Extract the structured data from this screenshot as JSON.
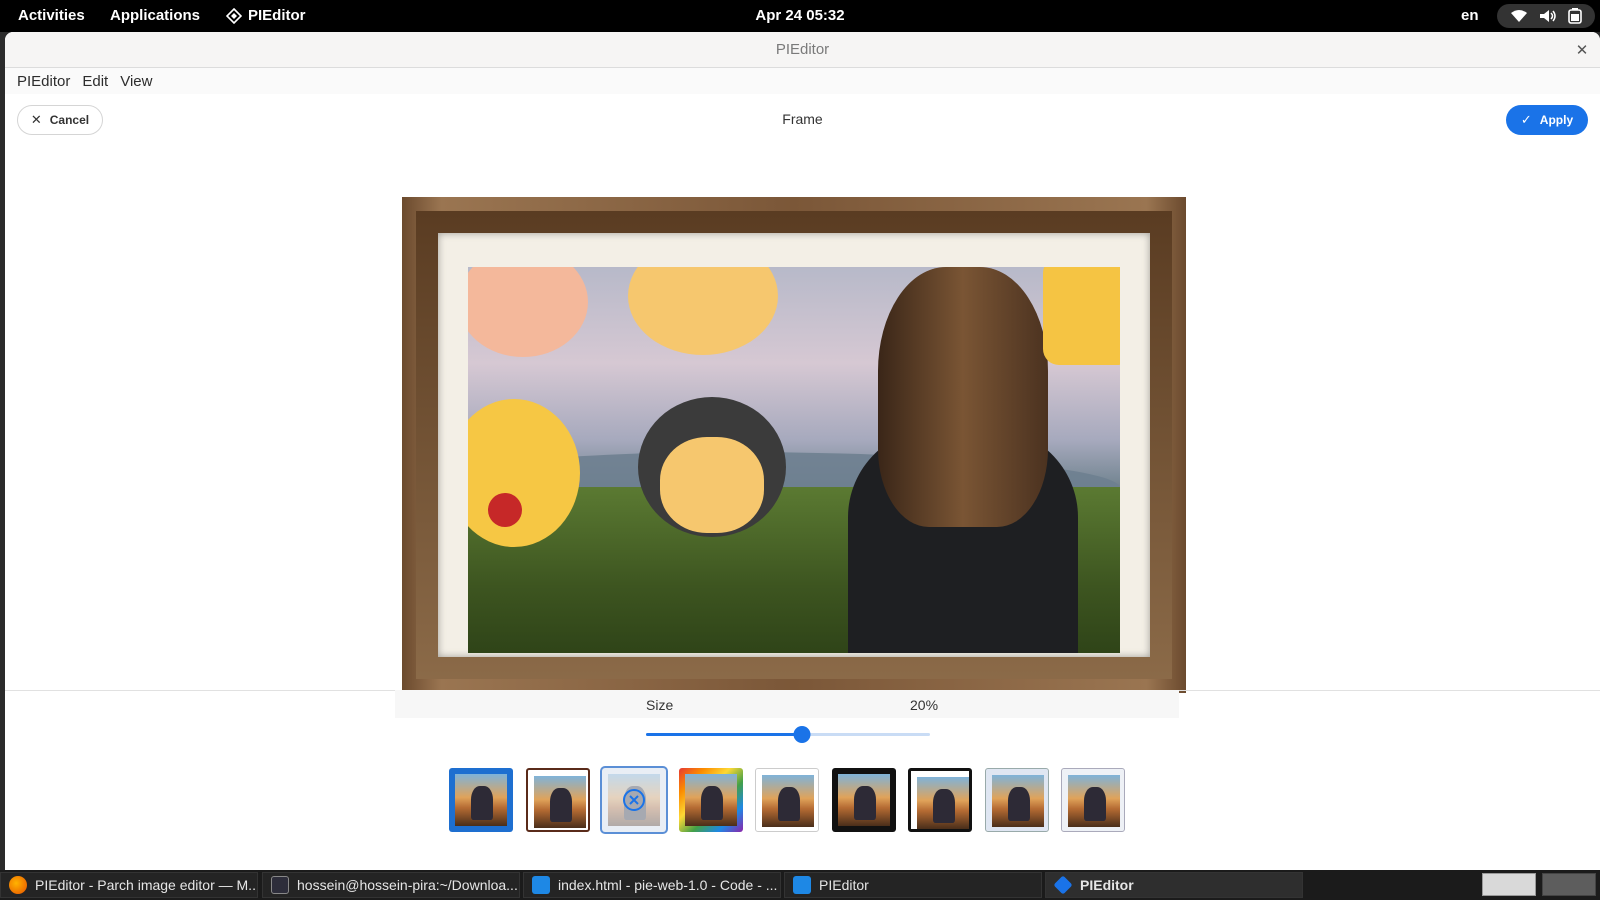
{
  "topbar": {
    "activities": "Activities",
    "applications": "Applications",
    "app_name": "PIEditor",
    "clock": "Apr 24  05:32",
    "lang": "en"
  },
  "window": {
    "title": "PIEditor",
    "menu": [
      "PIEditor",
      "Edit",
      "View"
    ]
  },
  "toolbar": {
    "cancel_label": "Cancel",
    "title": "Frame",
    "apply_label": "Apply",
    "accent": "#1a73e8"
  },
  "size_control": {
    "label": "Size",
    "value_text": "20%",
    "slider_fraction": 0.55
  },
  "frame_thumbnails": [
    {
      "style": "blue-border",
      "selected": false
    },
    {
      "style": "dark-thin-border",
      "selected": false
    },
    {
      "style": "none",
      "selected": true
    },
    {
      "style": "rainbow-border",
      "selected": false
    },
    {
      "style": "white-border",
      "selected": false
    },
    {
      "style": "black-thick-border",
      "selected": false
    },
    {
      "style": "black-white-border",
      "selected": false
    },
    {
      "style": "floral-border",
      "selected": false
    },
    {
      "style": "corner-ornament-border",
      "selected": false
    }
  ],
  "taskbar": {
    "tasks": [
      {
        "label": "PIEditor - Parch image editor — M...",
        "icon": "firefox-icon",
        "active": false
      },
      {
        "label": "hossein@hossein-pira:~/Downloa...",
        "icon": "terminal-icon",
        "active": false
      },
      {
        "label": "index.html - pie-web-1.0 - Code - ...",
        "icon": "code-icon",
        "active": false
      },
      {
        "label": "PIEditor",
        "icon": "document-icon",
        "active": false
      },
      {
        "label": "PIEditor",
        "icon": "pieditor-icon",
        "active": true
      }
    ]
  }
}
